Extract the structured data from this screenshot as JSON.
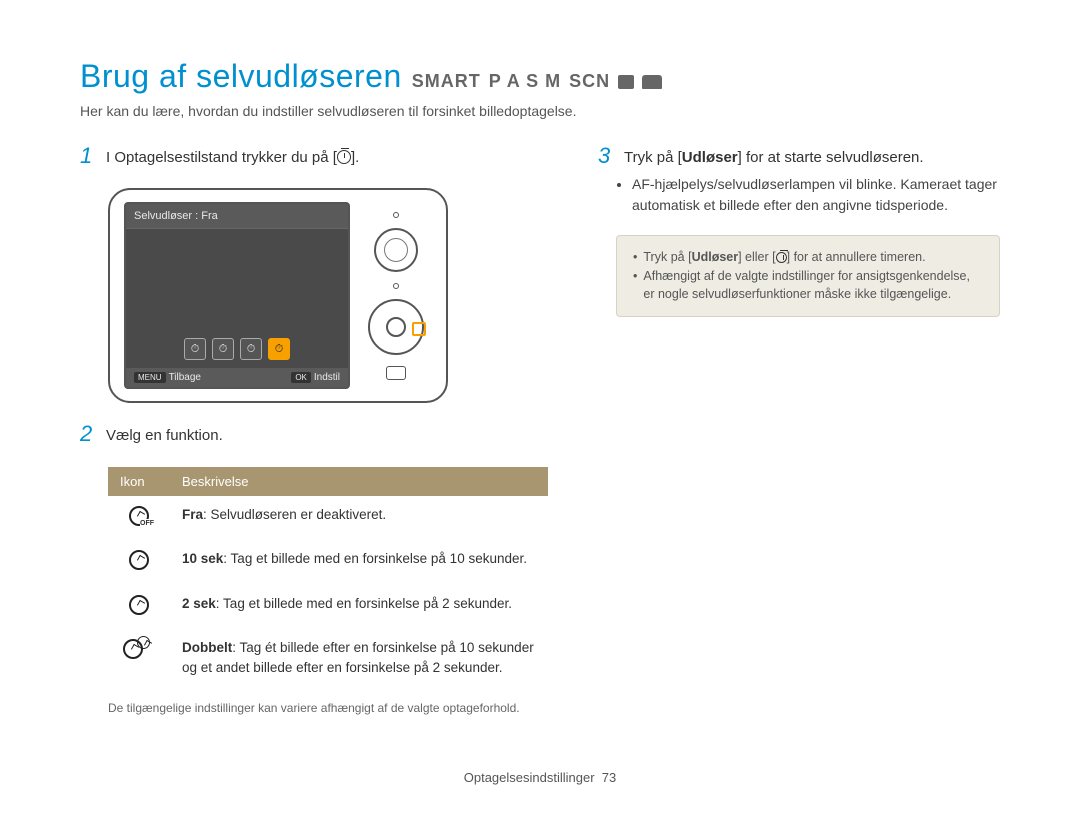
{
  "title": "Brug af selvudløseren",
  "mode_strip": {
    "smart": "SMART",
    "letters": "P A S M",
    "scn": "SCN"
  },
  "intro": "Her kan du lære, hvordan du indstiller selvudløseren til forsinket billedoptagelse.",
  "left": {
    "step1": {
      "num": "1",
      "text_before": "I Optagelsestilstand trykker du på [",
      "text_after": "]."
    },
    "camera": {
      "screen_title": "Selvudløser : Fra",
      "back_label_tag": "MENU",
      "back_label": "Tilbage",
      "set_label_tag": "OK",
      "set_label": "Indstil"
    },
    "step2": {
      "num": "2",
      "text": "Vælg en funktion."
    },
    "table": {
      "head_icon": "Ikon",
      "head_desc": "Beskrivelse",
      "rows": [
        {
          "icon": "off",
          "bold": "Fra",
          "rest": ": Selvudløseren er deaktiveret."
        },
        {
          "icon": "10",
          "bold": "10 sek",
          "rest": ": Tag et billede med en forsinkelse på 10 sekunder."
        },
        {
          "icon": "2",
          "bold": "2 sek",
          "rest": ": Tag et billede med en forsinkelse på 2 sekunder."
        },
        {
          "icon": "dbl",
          "bold": "Dobbelt",
          "rest": ": Tag ét billede efter en forsinkelse på 10 sekunder og et andet billede efter en forsinkelse på 2 sekunder."
        }
      ]
    },
    "table_note": "De tilgængelige indstillinger kan variere afhængigt af de valgte optageforhold."
  },
  "right": {
    "step3": {
      "num": "3",
      "text_before": "Tryk på [",
      "bold": "Udløser",
      "text_after": "] for at starte selvudløseren."
    },
    "bullet": "AF-hjælpelys/selvudløserlampen vil blinke. Kameraet tager automatisk et billede efter den angivne tidsperiode.",
    "info": [
      {
        "pre": "Tryk på [",
        "bold": "Udløser",
        "mid": "] eller [",
        "after": "] for at annullere timeren."
      },
      {
        "text": "Afhængigt af de valgte indstillinger for ansigtsgenkendelse, er nogle selvudløserfunktioner måske ikke tilgængelige."
      }
    ]
  },
  "footer": {
    "section": "Optagelsesindstillinger",
    "page": "73"
  }
}
